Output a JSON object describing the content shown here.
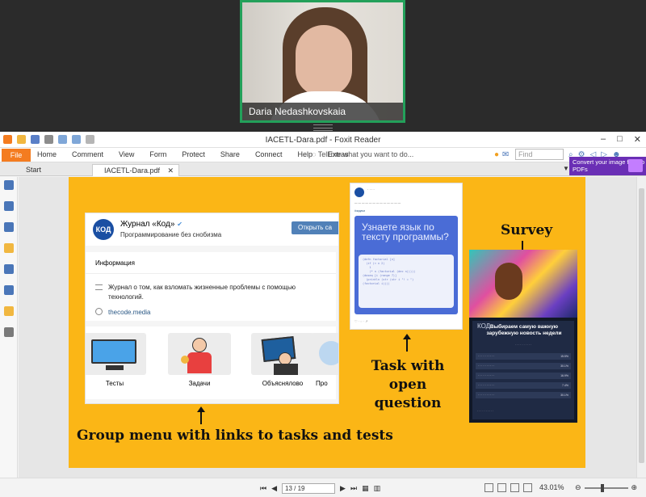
{
  "video": {
    "participant_name": "Daria Nedashkovskaia"
  },
  "app": {
    "title": "IACETL-Dara.pdf - Foxit Reader",
    "ribbon": {
      "file": "File",
      "menus": [
        "Home",
        "Comment",
        "View",
        "Form",
        "Protect",
        "Share",
        "Connect",
        "Help",
        "Extras"
      ],
      "tell_me": "Tell me what you want to do...",
      "find_placeholder": "Find"
    },
    "tabs": [
      {
        "label": "Start"
      },
      {
        "label": "IACETL-Dara.pdf"
      }
    ],
    "convert_banner": "Convert your image files to PDFs"
  },
  "slide": {
    "vk": {
      "logo": "КОД",
      "name": "Журнал «Код»",
      "subtitle": "Программирование без снобизма",
      "subscribe_button": "Открыть са",
      "info_header": "Информация",
      "description": "Журнал о том, как взломать жизненные проблемы с помощью технологий.",
      "link": "thecode.media",
      "menu_items": [
        "Тесты",
        "Задачи",
        "Объяснялово",
        "Про"
      ]
    },
    "telegram": {
      "card_title": "Узнаете язык по тексту программы?",
      "code_lines": [
        "(defn factorial [n]",
        "  (if (< n 2)",
        "    1",
        "    (* n (factorial (dec n)))))",
        "(doseq [i (range 7)]",
        "  (println (str (str i \"! = \")",
        "(factorial i))))"
      ],
      "footer_tag": "#задачи"
    },
    "labels": {
      "survey": "Survey",
      "task": "Task with open question",
      "group_menu": "Group menu with links to tasks and tests"
    },
    "survey": {
      "logo": "КОД",
      "title": "Выбираем самую важную зарубежную новость недели",
      "options": [
        {
          "pct": "15.5%"
        },
        {
          "pct": "30.1%"
        },
        {
          "pct": "16.9%"
        },
        {
          "pct": "7.4%"
        },
        {
          "pct": "30.1%"
        }
      ]
    }
  },
  "status": {
    "page": "13 / 19",
    "zoom": "43.01%"
  }
}
